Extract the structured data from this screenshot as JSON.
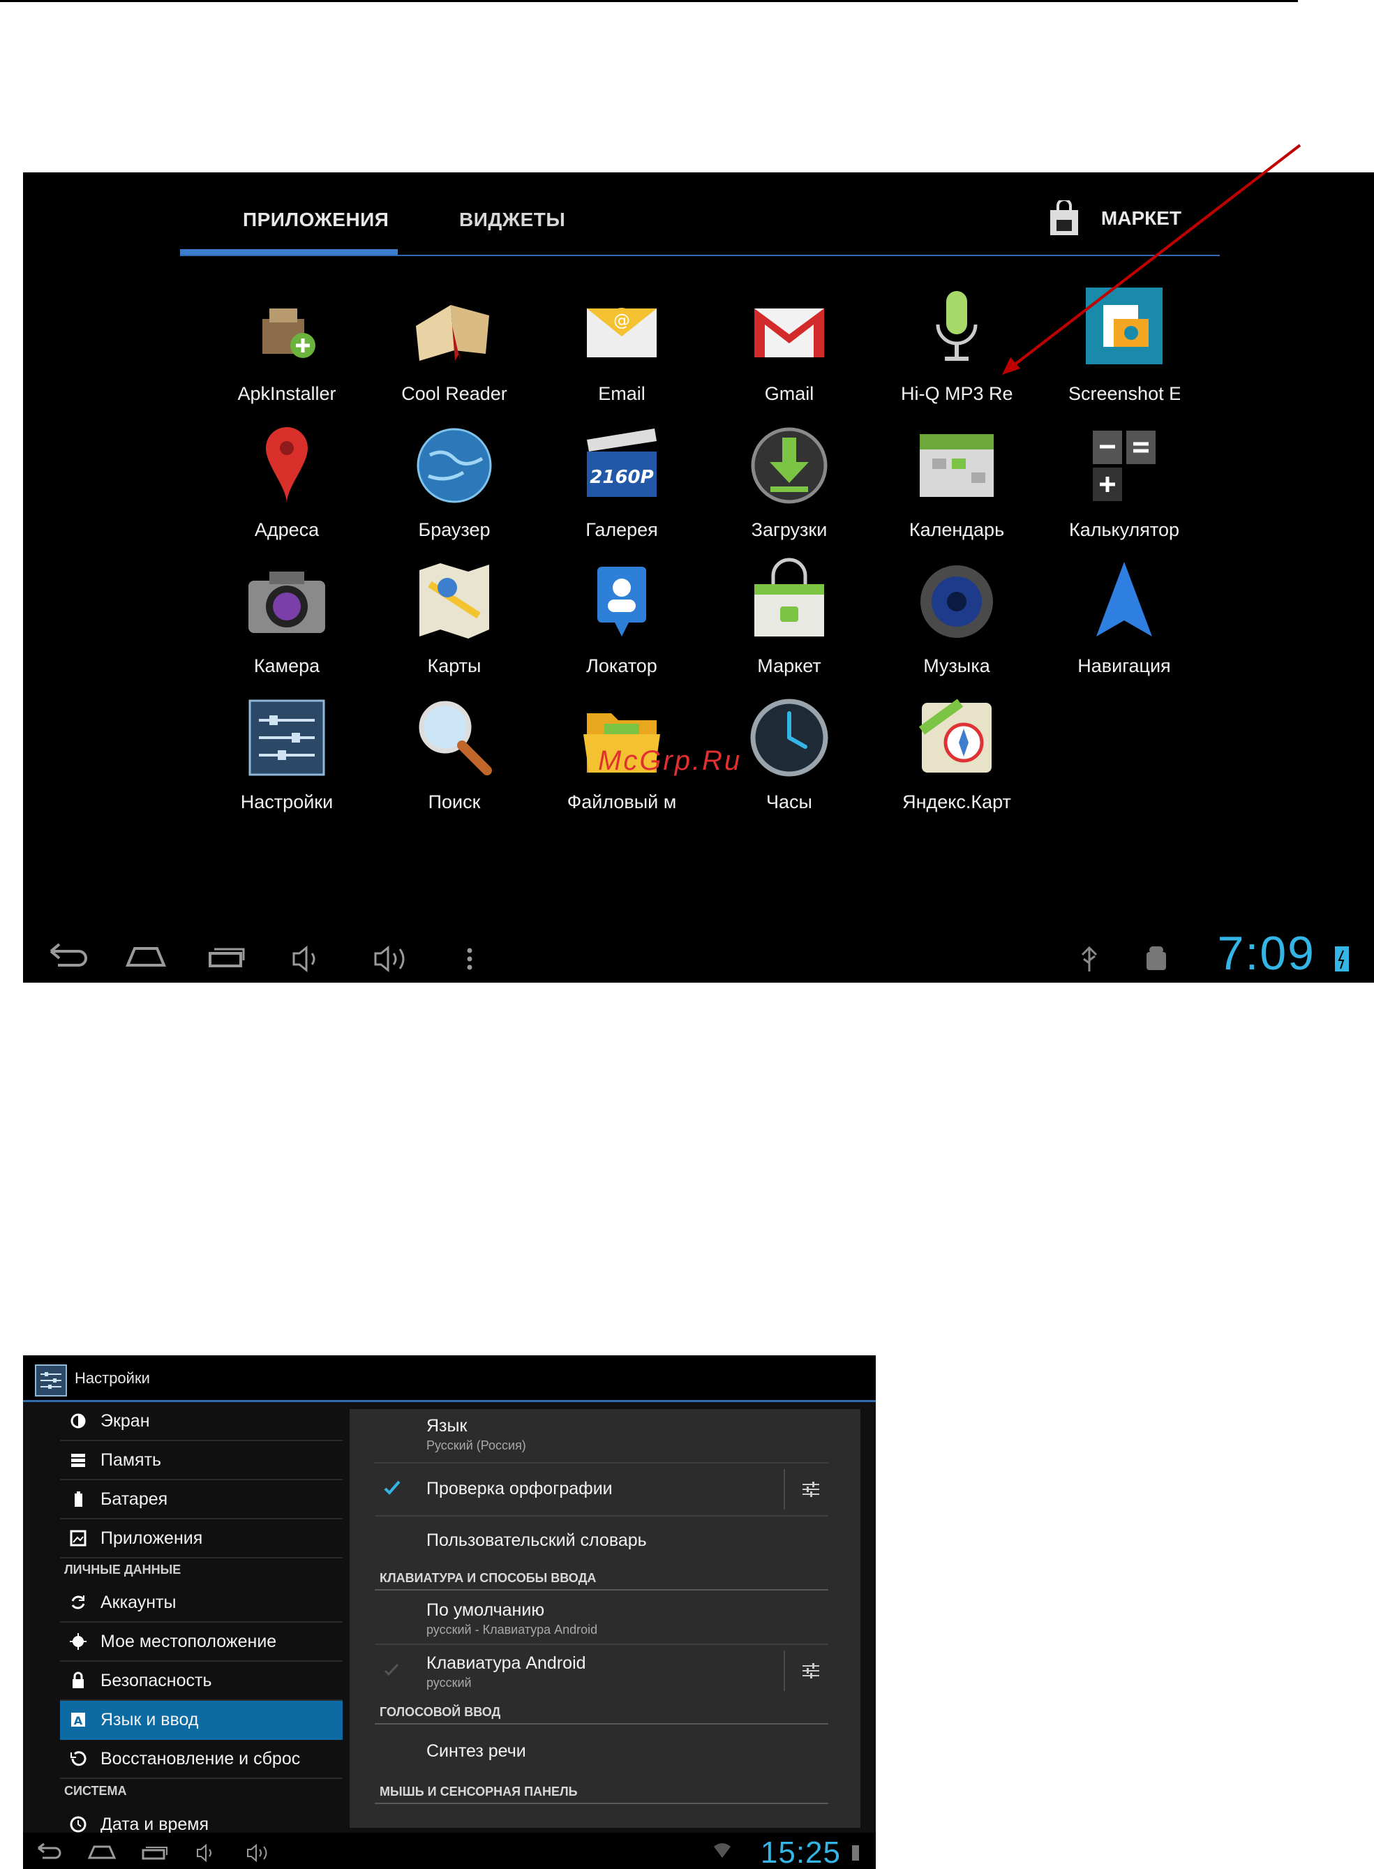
{
  "shot1": {
    "tabs": {
      "apps": "ПРИЛОЖЕНИЯ",
      "widgets": "ВИДЖЕТЫ",
      "market": "МАРКЕТ"
    },
    "apps": [
      {
        "label": "ApkInstaller",
        "icon": "apk-installer-icon"
      },
      {
        "label": "Cool Reader",
        "icon": "book-icon"
      },
      {
        "label": "Email",
        "icon": "email-icon"
      },
      {
        "label": "Gmail",
        "icon": "gmail-icon"
      },
      {
        "label": "Hi-Q MP3 Re",
        "icon": "microphone-icon"
      },
      {
        "label": "Screenshot E",
        "icon": "screenshot-icon"
      },
      {
        "label": "Адреса",
        "icon": "map-pin-icon"
      },
      {
        "label": "Браузер",
        "icon": "globe-icon"
      },
      {
        "label": "Галерея",
        "icon": "clapper-icon"
      },
      {
        "label": "Загрузки",
        "icon": "download-icon"
      },
      {
        "label": "Календарь",
        "icon": "calendar-icon"
      },
      {
        "label": "Калькулятор",
        "icon": "calculator-icon"
      },
      {
        "label": "Камера",
        "icon": "camera-icon"
      },
      {
        "label": "Карты",
        "icon": "maps-icon"
      },
      {
        "label": "Локатор",
        "icon": "locator-icon"
      },
      {
        "label": "Маркет",
        "icon": "market-bag-icon"
      },
      {
        "label": "Музыка",
        "icon": "speaker-icon"
      },
      {
        "label": "Навигация",
        "icon": "navigation-arrow-icon"
      },
      {
        "label": "Настройки",
        "icon": "settings-sliders-icon"
      },
      {
        "label": "Поиск",
        "icon": "magnifier-icon"
      },
      {
        "label": "Файловый м",
        "icon": "file-manager-icon"
      },
      {
        "label": "Часы",
        "icon": "clock-icon"
      },
      {
        "label": "Яндекс.Карт",
        "icon": "yandex-maps-icon"
      }
    ],
    "watermark": "McGrp.Ru",
    "clock": "7:09",
    "colors": {
      "accent": "#33b5e5",
      "tab_indicator": "#3d7ecf",
      "annotation_arrow": "#c00000"
    }
  },
  "shot2": {
    "title": "Настройки",
    "sidebar": {
      "items_top": [
        {
          "label": "Экран",
          "icon": "brightness-icon"
        },
        {
          "label": "Память",
          "icon": "storage-icon"
        },
        {
          "label": "Батарея",
          "icon": "battery-icon"
        },
        {
          "label": "Приложения",
          "icon": "apps-icon"
        }
      ],
      "personal_header": "ЛИЧНЫЕ ДАННЫЕ",
      "items_personal": [
        {
          "label": "Аккаунты",
          "icon": "sync-icon"
        },
        {
          "label": "Мое местоположение",
          "icon": "location-icon"
        },
        {
          "label": "Безопасность",
          "icon": "lock-icon"
        },
        {
          "label": "Язык и ввод",
          "icon": "keyboard-a-icon"
        },
        {
          "label": "Восстановление и сброс",
          "icon": "restore-icon"
        }
      ],
      "system_header": "СИСТЕМА",
      "items_system": [
        {
          "label": "Дата и время",
          "icon": "clock-small-icon"
        }
      ]
    },
    "pane": {
      "language_title": "Язык",
      "language_value": "Русский (Россия)",
      "spellcheck": "Проверка орфографии",
      "user_dict": "Пользовательский словарь",
      "keyboard_section": "КЛАВИАТУРА И СПОСОБЫ ВВОДА",
      "default_title": "По умолчанию",
      "default_value": "русский - Клавиатура Android",
      "android_kb_title": "Клавиатура Android",
      "android_kb_value": "русский",
      "voice_section": "ГОЛОСОВОЙ ВВОД",
      "tts": "Синтез речи",
      "mouse_section": "МЫШЬ И СЕНСОРНАЯ ПАНЕЛЬ"
    },
    "clock": "15:25"
  }
}
